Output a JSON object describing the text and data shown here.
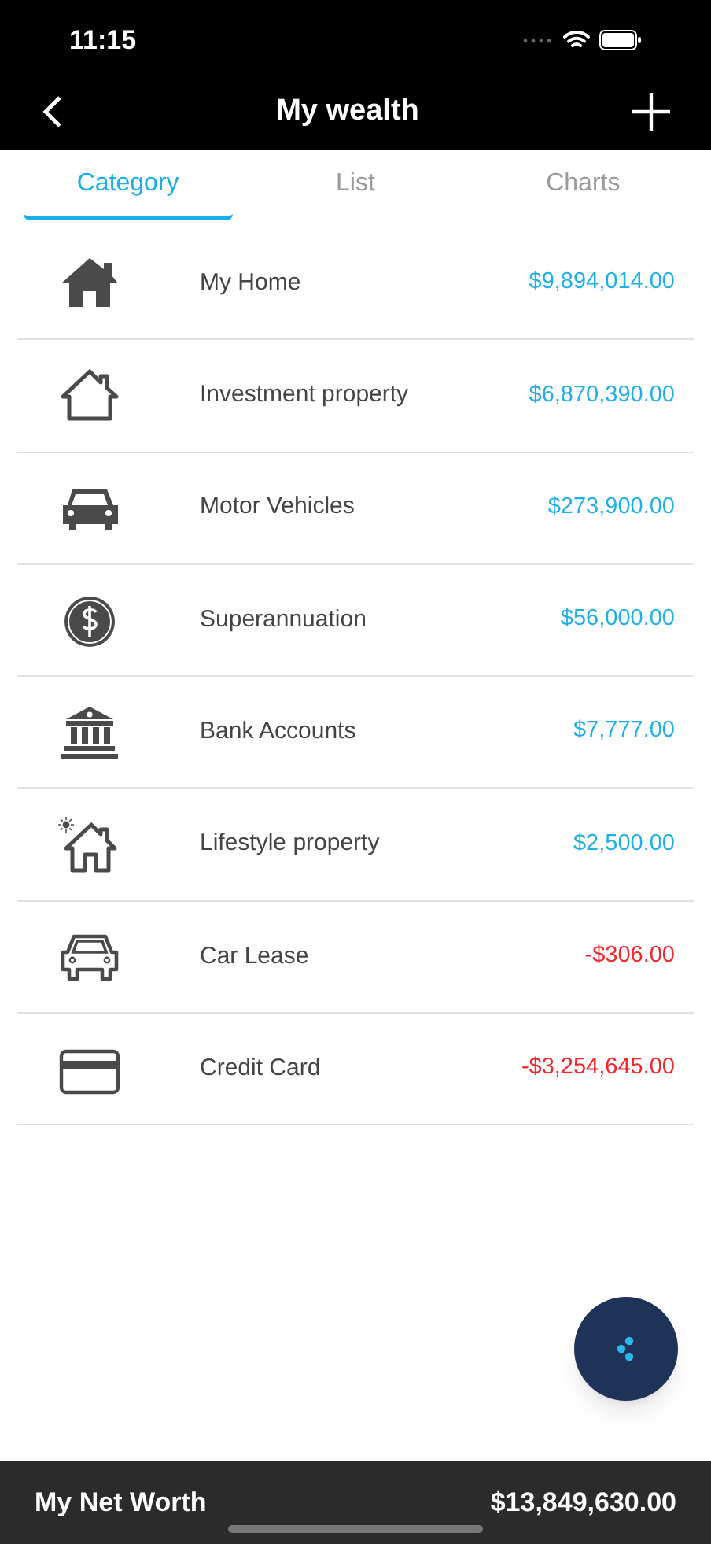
{
  "status_bar": {
    "time": "11:15"
  },
  "nav": {
    "title": "My wealth"
  },
  "tabs": [
    {
      "label": "Category",
      "selected": true
    },
    {
      "label": "List",
      "selected": false
    },
    {
      "label": "Charts",
      "selected": false
    }
  ],
  "categories": [
    {
      "kind": "home",
      "name": "My Home",
      "amount": "$9,894,014.00",
      "negative": false
    },
    {
      "kind": "house-outline",
      "name": "Investment property",
      "amount": "$6,870,390.00",
      "negative": false
    },
    {
      "kind": "car",
      "name": "Motor Vehicles",
      "amount": "$273,900.00",
      "negative": false
    },
    {
      "kind": "dollar",
      "name": "Superannuation",
      "amount": "$56,000.00",
      "negative": false
    },
    {
      "kind": "bank",
      "name": "Bank Accounts",
      "amount": "$7,777.00",
      "negative": false
    },
    {
      "kind": "lifestyle",
      "name": "Lifestyle property",
      "amount": "$2,500.00",
      "negative": false
    },
    {
      "kind": "car-outline",
      "name": "Car Lease",
      "amount": "-$306.00",
      "negative": true
    },
    {
      "kind": "card",
      "name": "Credit Card",
      "amount": "-$3,254,645.00",
      "negative": true
    }
  ],
  "footer": {
    "label": "My Net Worth",
    "total": "$13,849,630.00"
  }
}
